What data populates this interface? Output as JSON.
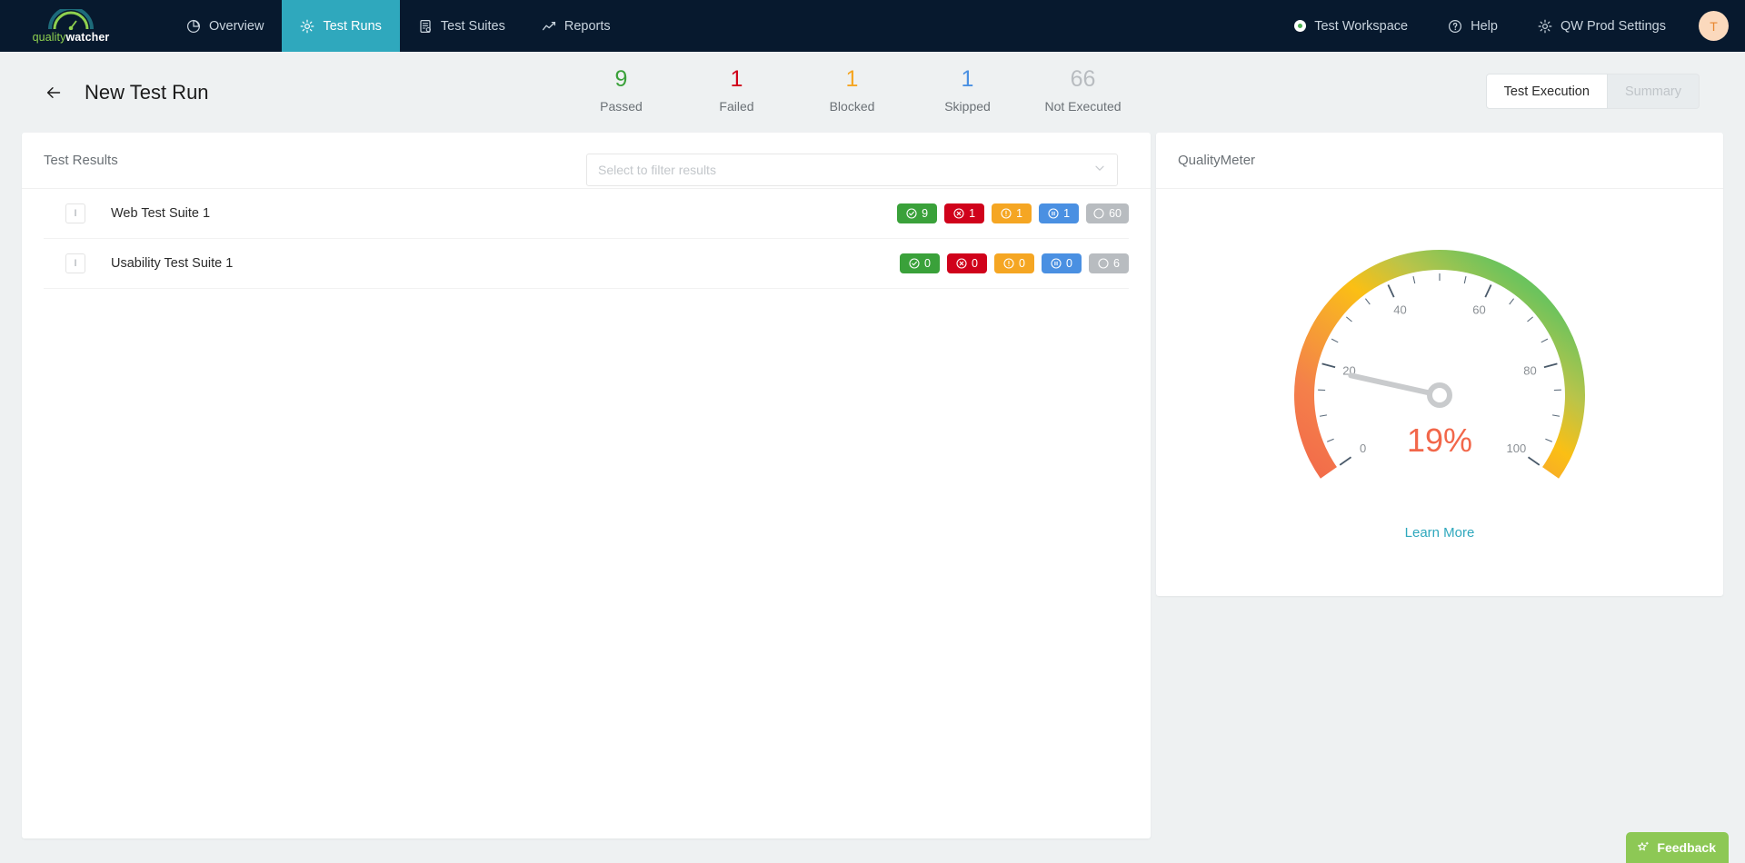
{
  "navbar": {
    "logo": {
      "text_primary": "quality",
      "text_secondary": "watcher",
      "icon": "gauge-arc-logo"
    },
    "items": [
      {
        "label": "Overview",
        "icon": "pie-chart-icon",
        "active": false
      },
      {
        "label": "Test Runs",
        "icon": "gear-icon",
        "active": true
      },
      {
        "label": "Test Suites",
        "icon": "list-document-icon",
        "active": false
      },
      {
        "label": "Reports",
        "icon": "line-chart-icon",
        "active": false
      }
    ],
    "right_items": [
      {
        "label": "Test Workspace",
        "icon": "status-dot-icon"
      },
      {
        "label": "Help",
        "icon": "question-circle-icon"
      },
      {
        "label": "QW Prod Settings",
        "icon": "gear-icon"
      }
    ],
    "avatar_initial": "T",
    "accent_color": "#2fa8bd",
    "background_color": "#07192e"
  },
  "subheader": {
    "back_icon": "arrow-left-icon",
    "title": "New Test Run",
    "stats": [
      {
        "value": "9",
        "label": "Passed",
        "color": "#3aa13a"
      },
      {
        "value": "1",
        "label": "Failed",
        "color": "#d0021b"
      },
      {
        "value": "1",
        "label": "Blocked",
        "color": "#f5a623"
      },
      {
        "value": "1",
        "label": "Skipped",
        "color": "#4a90e2"
      },
      {
        "value": "66",
        "label": "Not Executed",
        "color": "#b8bcc0"
      }
    ],
    "segments": [
      {
        "label": "Test Execution",
        "active": true
      },
      {
        "label": "Summary",
        "active": false
      }
    ]
  },
  "results_panel": {
    "title": "Test Results",
    "filter": {
      "placeholder": "Select to filter results",
      "value": "",
      "chevron": "chevron-down-icon"
    },
    "rows": [
      {
        "handle": "I",
        "name": "Web Test Suite 1",
        "badges": [
          {
            "type": "passed",
            "value": "9",
            "icon": "check-circle-icon"
          },
          {
            "type": "failed",
            "value": "1",
            "icon": "x-circle-icon"
          },
          {
            "type": "blocked",
            "value": "1",
            "icon": "exclamation-circle-icon"
          },
          {
            "type": "skipped",
            "value": "1",
            "icon": "pause-circle-icon"
          },
          {
            "type": "notexec",
            "value": "60",
            "icon": "empty-circle-icon"
          }
        ]
      },
      {
        "handle": "I",
        "name": "Usability Test Suite 1",
        "badges": [
          {
            "type": "passed",
            "value": "0",
            "icon": "check-circle-icon"
          },
          {
            "type": "failed",
            "value": "0",
            "icon": "x-circle-icon"
          },
          {
            "type": "blocked",
            "value": "0",
            "icon": "exclamation-circle-icon"
          },
          {
            "type": "skipped",
            "value": "0",
            "icon": "pause-circle-icon"
          },
          {
            "type": "notexec",
            "value": "6",
            "icon": "empty-circle-icon"
          }
        ]
      }
    ]
  },
  "quality_panel": {
    "title": "QualityMeter",
    "value_label": "19%",
    "link_label": "Learn More"
  },
  "chart_data": {
    "type": "gauge",
    "title": "QualityMeter",
    "value": 19,
    "value_label": "19%",
    "unit": "%",
    "min": 0,
    "max": 100,
    "major_ticks": [
      0,
      20,
      40,
      60,
      80,
      100
    ],
    "minor_tick_step": 5,
    "start_angle_deg": -215,
    "end_angle_deg": 35,
    "arc_gradient": [
      "#f2674a",
      "#f5a623",
      "#f5c518",
      "#9ac650",
      "#3ec46d"
    ],
    "value_color": "#f2674a",
    "needle_color": "#c9cbcd",
    "tick_label_color": "#8a8f94"
  },
  "feedback": {
    "label": "Feedback",
    "icon": "sparkle-star-icon",
    "color": "#8dc855"
  }
}
